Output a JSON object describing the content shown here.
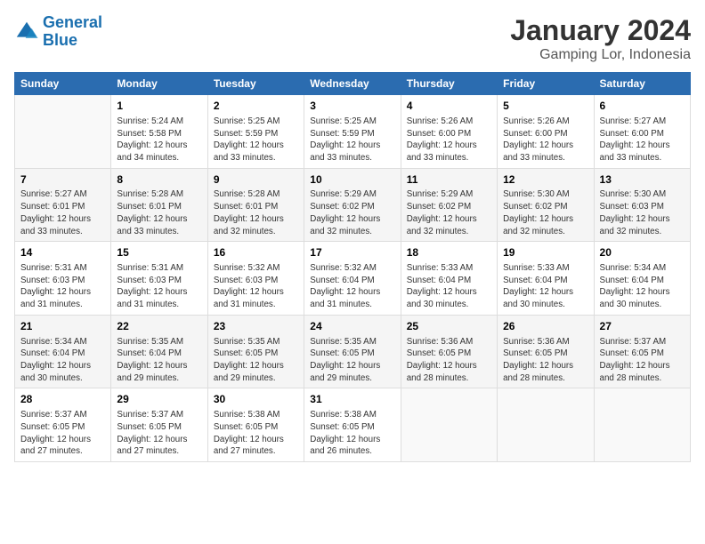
{
  "logo": {
    "line1": "General",
    "line2": "Blue"
  },
  "title": "January 2024",
  "location": "Gamping Lor, Indonesia",
  "headers": [
    "Sunday",
    "Monday",
    "Tuesday",
    "Wednesday",
    "Thursday",
    "Friday",
    "Saturday"
  ],
  "weeks": [
    [
      {
        "num": "",
        "info": ""
      },
      {
        "num": "1",
        "info": "Sunrise: 5:24 AM\nSunset: 5:58 PM\nDaylight: 12 hours\nand 34 minutes."
      },
      {
        "num": "2",
        "info": "Sunrise: 5:25 AM\nSunset: 5:59 PM\nDaylight: 12 hours\nand 33 minutes."
      },
      {
        "num": "3",
        "info": "Sunrise: 5:25 AM\nSunset: 5:59 PM\nDaylight: 12 hours\nand 33 minutes."
      },
      {
        "num": "4",
        "info": "Sunrise: 5:26 AM\nSunset: 6:00 PM\nDaylight: 12 hours\nand 33 minutes."
      },
      {
        "num": "5",
        "info": "Sunrise: 5:26 AM\nSunset: 6:00 PM\nDaylight: 12 hours\nand 33 minutes."
      },
      {
        "num": "6",
        "info": "Sunrise: 5:27 AM\nSunset: 6:00 PM\nDaylight: 12 hours\nand 33 minutes."
      }
    ],
    [
      {
        "num": "7",
        "info": "Sunrise: 5:27 AM\nSunset: 6:01 PM\nDaylight: 12 hours\nand 33 minutes."
      },
      {
        "num": "8",
        "info": "Sunrise: 5:28 AM\nSunset: 6:01 PM\nDaylight: 12 hours\nand 33 minutes."
      },
      {
        "num": "9",
        "info": "Sunrise: 5:28 AM\nSunset: 6:01 PM\nDaylight: 12 hours\nand 32 minutes."
      },
      {
        "num": "10",
        "info": "Sunrise: 5:29 AM\nSunset: 6:02 PM\nDaylight: 12 hours\nand 32 minutes."
      },
      {
        "num": "11",
        "info": "Sunrise: 5:29 AM\nSunset: 6:02 PM\nDaylight: 12 hours\nand 32 minutes."
      },
      {
        "num": "12",
        "info": "Sunrise: 5:30 AM\nSunset: 6:02 PM\nDaylight: 12 hours\nand 32 minutes."
      },
      {
        "num": "13",
        "info": "Sunrise: 5:30 AM\nSunset: 6:03 PM\nDaylight: 12 hours\nand 32 minutes."
      }
    ],
    [
      {
        "num": "14",
        "info": "Sunrise: 5:31 AM\nSunset: 6:03 PM\nDaylight: 12 hours\nand 31 minutes."
      },
      {
        "num": "15",
        "info": "Sunrise: 5:31 AM\nSunset: 6:03 PM\nDaylight: 12 hours\nand 31 minutes."
      },
      {
        "num": "16",
        "info": "Sunrise: 5:32 AM\nSunset: 6:03 PM\nDaylight: 12 hours\nand 31 minutes."
      },
      {
        "num": "17",
        "info": "Sunrise: 5:32 AM\nSunset: 6:04 PM\nDaylight: 12 hours\nand 31 minutes."
      },
      {
        "num": "18",
        "info": "Sunrise: 5:33 AM\nSunset: 6:04 PM\nDaylight: 12 hours\nand 30 minutes."
      },
      {
        "num": "19",
        "info": "Sunrise: 5:33 AM\nSunset: 6:04 PM\nDaylight: 12 hours\nand 30 minutes."
      },
      {
        "num": "20",
        "info": "Sunrise: 5:34 AM\nSunset: 6:04 PM\nDaylight: 12 hours\nand 30 minutes."
      }
    ],
    [
      {
        "num": "21",
        "info": "Sunrise: 5:34 AM\nSunset: 6:04 PM\nDaylight: 12 hours\nand 30 minutes."
      },
      {
        "num": "22",
        "info": "Sunrise: 5:35 AM\nSunset: 6:04 PM\nDaylight: 12 hours\nand 29 minutes."
      },
      {
        "num": "23",
        "info": "Sunrise: 5:35 AM\nSunset: 6:05 PM\nDaylight: 12 hours\nand 29 minutes."
      },
      {
        "num": "24",
        "info": "Sunrise: 5:35 AM\nSunset: 6:05 PM\nDaylight: 12 hours\nand 29 minutes."
      },
      {
        "num": "25",
        "info": "Sunrise: 5:36 AM\nSunset: 6:05 PM\nDaylight: 12 hours\nand 28 minutes."
      },
      {
        "num": "26",
        "info": "Sunrise: 5:36 AM\nSunset: 6:05 PM\nDaylight: 12 hours\nand 28 minutes."
      },
      {
        "num": "27",
        "info": "Sunrise: 5:37 AM\nSunset: 6:05 PM\nDaylight: 12 hours\nand 28 minutes."
      }
    ],
    [
      {
        "num": "28",
        "info": "Sunrise: 5:37 AM\nSunset: 6:05 PM\nDaylight: 12 hours\nand 27 minutes."
      },
      {
        "num": "29",
        "info": "Sunrise: 5:37 AM\nSunset: 6:05 PM\nDaylight: 12 hours\nand 27 minutes."
      },
      {
        "num": "30",
        "info": "Sunrise: 5:38 AM\nSunset: 6:05 PM\nDaylight: 12 hours\nand 27 minutes."
      },
      {
        "num": "31",
        "info": "Sunrise: 5:38 AM\nSunset: 6:05 PM\nDaylight: 12 hours\nand 26 minutes."
      },
      {
        "num": "",
        "info": ""
      },
      {
        "num": "",
        "info": ""
      },
      {
        "num": "",
        "info": ""
      }
    ]
  ]
}
